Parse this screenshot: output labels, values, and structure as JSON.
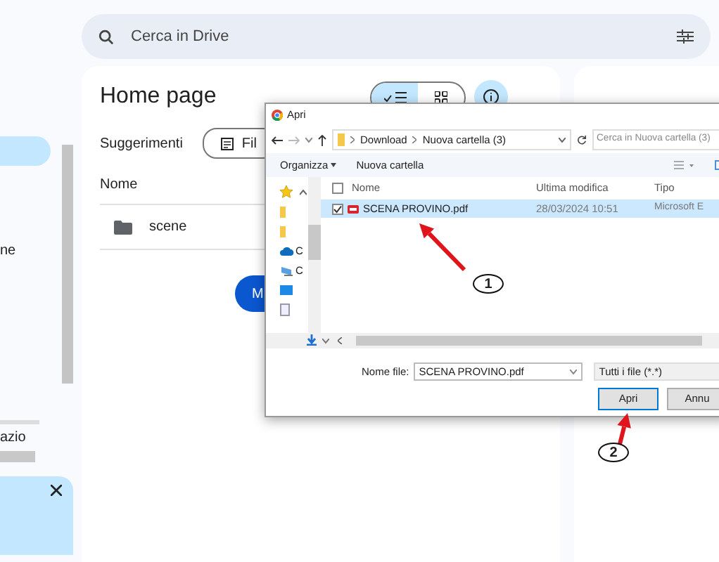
{
  "sidebar": {
    "items": [
      {
        "label": "ne"
      },
      {
        "label": "azio"
      }
    ]
  },
  "search": {
    "placeholder": "Cerca in Drive"
  },
  "home": {
    "title": "Home page",
    "suggestions_label": "Suggerimenti",
    "chips": [
      {
        "label": "Fil"
      }
    ],
    "view_toggle": [
      {
        "kind": "list",
        "selected": true
      },
      {
        "kind": "grid",
        "selected": false
      }
    ],
    "column": "Nome",
    "rows": [
      {
        "name": "scene"
      }
    ],
    "button": "M"
  },
  "dialog": {
    "title": "Apri",
    "path": [
      "Download",
      "Nuova cartella (3)"
    ],
    "search_placeholder": "Cerca in Nuova cartella (3)",
    "toolbar": [
      "Organizza",
      "Nuova cartella"
    ],
    "nav": [
      {
        "kind": "star"
      },
      {
        "kind": "folder"
      },
      {
        "kind": "folder"
      },
      {
        "kind": "cloud",
        "label": "C"
      },
      {
        "kind": "computer",
        "label": "C"
      },
      {
        "kind": "mail"
      },
      {
        "kind": "doc"
      }
    ],
    "columns": [
      "Nome",
      "Ultima modifica",
      "Tipo"
    ],
    "header_checked": false,
    "files": [
      {
        "name": "SCENA PROVINO.pdf",
        "modified": "28/03/2024 10:51",
        "type": "Microsoft E",
        "selected": true,
        "checked": true
      }
    ],
    "filename_label": "Nome file:",
    "filename": "SCENA PROVINO.pdf",
    "filter": "Tutti i file (*.*)",
    "buttons": [
      "Apri",
      "Annu"
    ]
  },
  "annotations": [
    {
      "label": "1"
    },
    {
      "label": "2"
    }
  ]
}
